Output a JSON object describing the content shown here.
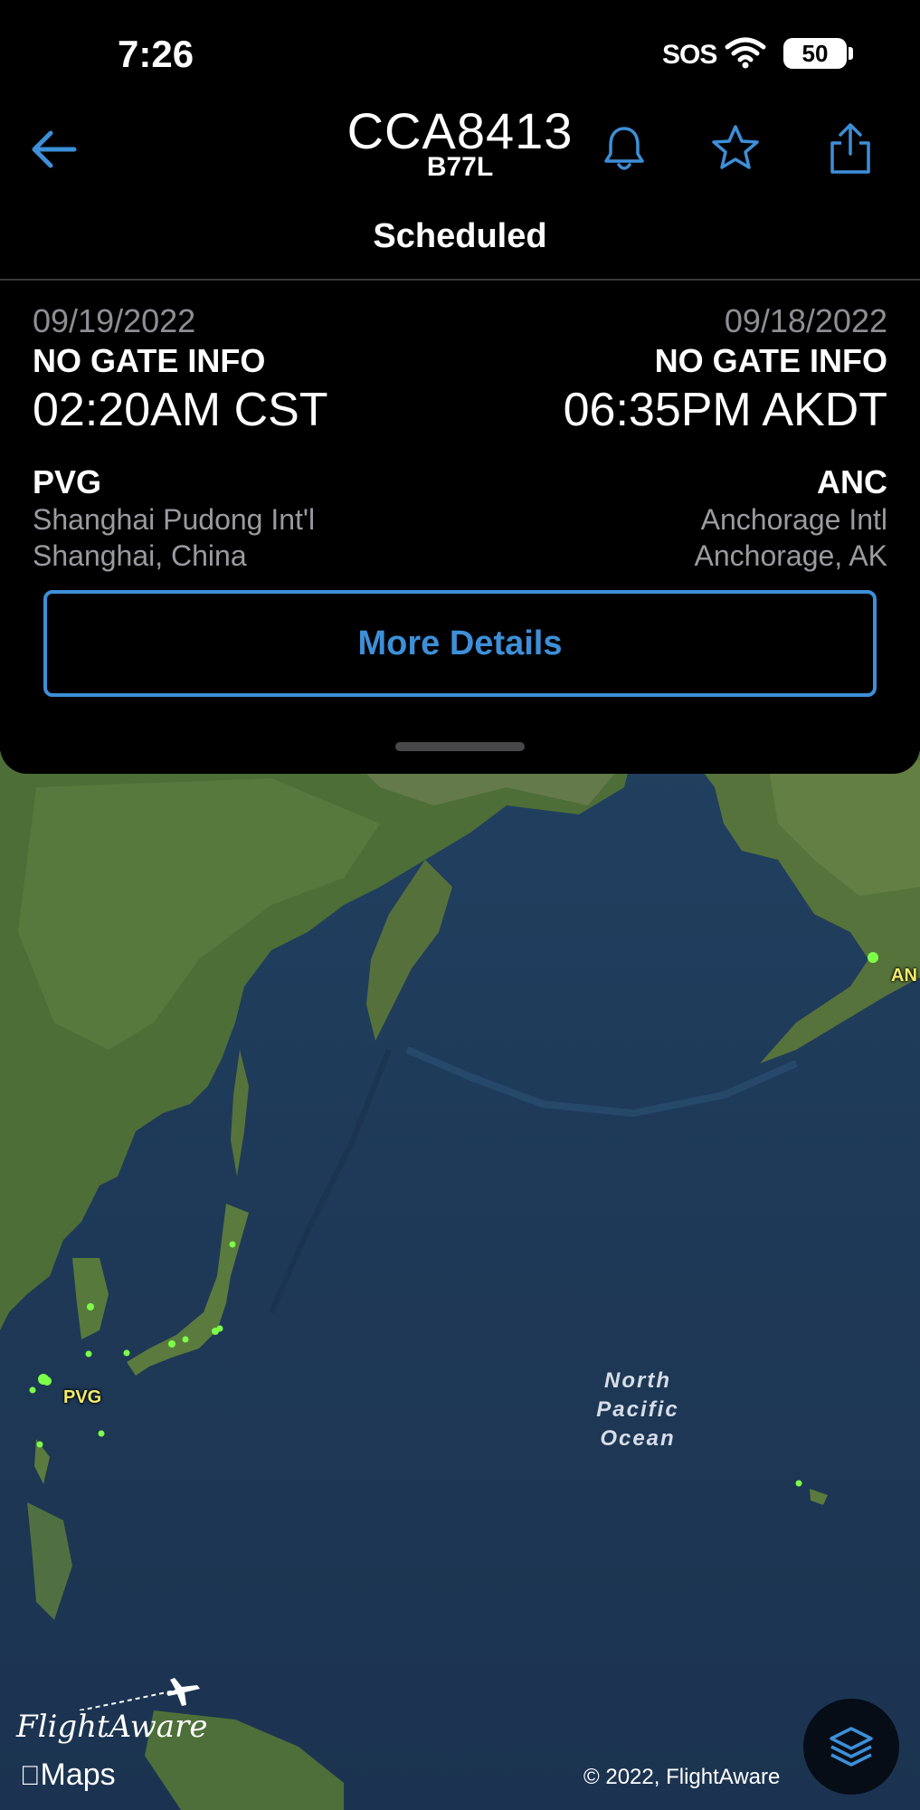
{
  "status_bar": {
    "time": "7:26",
    "signal_text": "SOS",
    "battery": "50"
  },
  "header": {
    "flight_id": "CCA8413",
    "aircraft": "B77L",
    "status": "Scheduled",
    "icons": [
      "back-arrow-icon",
      "bell-icon",
      "star-icon",
      "share-icon"
    ],
    "accent_color": "#3d8fd8"
  },
  "departure": {
    "date": "09/19/2022",
    "gate": "NO GATE INFO",
    "time": "02:20AM CST",
    "code": "PVG",
    "airport": "Shanghai Pudong Int'l",
    "city": "Shanghai, China"
  },
  "arrival": {
    "date": "09/18/2022",
    "gate": "NO GATE INFO",
    "time": "06:35PM AKDT",
    "code": "ANC",
    "airport": "Anchorage Intl",
    "city": "Anchorage, AK"
  },
  "actions": {
    "more_details": "More Details"
  },
  "map": {
    "ocean_label": "North Pacific Ocean",
    "origin_label": "PVG",
    "destination_label": "AN",
    "brand": "FlightAware",
    "maps_credit": "Maps",
    "copyright": "© 2022, FlightAware",
    "layers_icon": "layers-icon",
    "airport_dot_color": "#7dff4a"
  }
}
